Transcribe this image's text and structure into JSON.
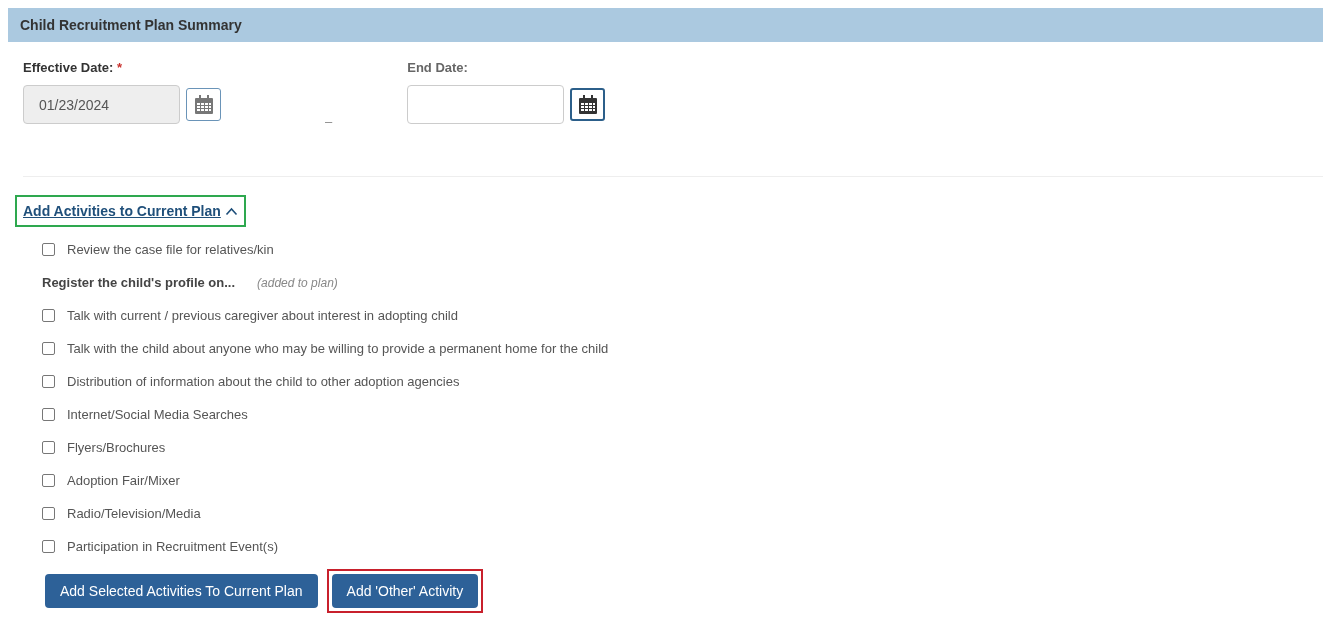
{
  "panel": {
    "title": "Child Recruitment Plan Summary"
  },
  "effective_date": {
    "label": "Effective Date:",
    "required_mark": "*",
    "value": "01/23/2024",
    "disabled": true
  },
  "separator": "–",
  "end_date": {
    "label": "End Date:",
    "disabled": false
  },
  "section_link": {
    "label": "Add Activities to Current Plan",
    "expanded": true,
    "highlighted": true
  },
  "activities": [
    {
      "kind": "checkbox",
      "label": "Review the case file for relatives/kin",
      "checked": false
    },
    {
      "kind": "heading",
      "label": "Register the child's profile on...",
      "note": "(added to plan)"
    },
    {
      "kind": "checkbox",
      "label": "Talk with current / previous caregiver about interest in adopting child",
      "checked": false
    },
    {
      "kind": "checkbox",
      "label": "Talk with the child about anyone who may be willing to provide a permanent home for the child",
      "checked": false
    },
    {
      "kind": "checkbox",
      "label": "Distribution of information about the child to other adoption agencies",
      "checked": false
    },
    {
      "kind": "checkbox",
      "label": "Internet/Social Media Searches",
      "checked": false
    },
    {
      "kind": "checkbox",
      "label": "Flyers/Brochures",
      "checked": false
    },
    {
      "kind": "checkbox",
      "label": "Adoption Fair/Mixer",
      "checked": false
    },
    {
      "kind": "checkbox",
      "label": "Radio/Television/Media",
      "checked": false
    },
    {
      "kind": "checkbox",
      "label": "Participation in Recruitment Event(s)",
      "checked": false
    }
  ],
  "buttons": [
    {
      "label": "Add Selected Activities To Current Plan",
      "highlighted": false
    },
    {
      "label": "Add 'Other' Activity",
      "highlighted": true
    }
  ]
}
